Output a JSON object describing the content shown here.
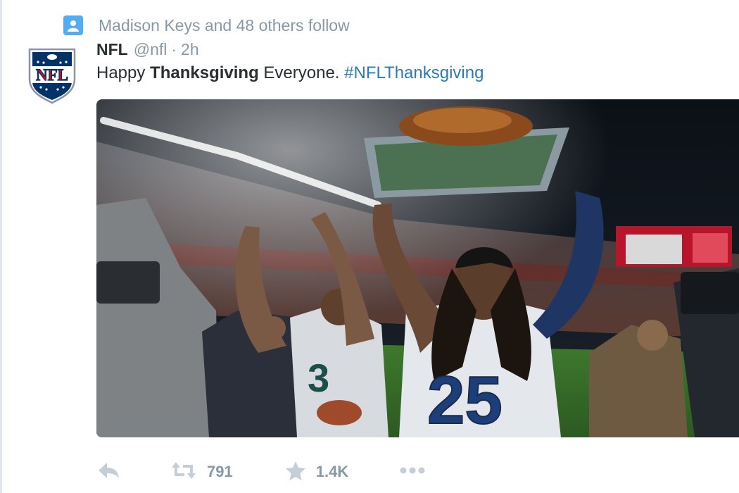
{
  "context": {
    "icon": "person-icon",
    "text": "Madison Keys and 48 others follow"
  },
  "tweet": {
    "author_name": "NFL",
    "author_handle": "@nfl",
    "separator": "·",
    "time": "2h",
    "text_before": "Happy ",
    "text_bold": "Thanksgiving",
    "text_after": " Everyone. ",
    "hashtag": "#NFLThanksgiving",
    "avatar": "nfl-shield-logo"
  },
  "media": {
    "description_icon": "photo-stadium-player-holding-turkey-platter",
    "jersey_numbers": [
      "3",
      "25"
    ]
  },
  "actions": {
    "reply_icon": "reply-icon",
    "retweet_icon": "retweet-icon",
    "retweet_count": "791",
    "favorite_icon": "star-icon",
    "favorite_count": "1.4K",
    "more_icon": "more-icon"
  },
  "colors": {
    "link": "#2b7bb9",
    "muted": "#8899a6",
    "text": "#292f33",
    "accent": "#55acee",
    "nfl_blue": "#013369",
    "nfl_red": "#d50a0a"
  }
}
